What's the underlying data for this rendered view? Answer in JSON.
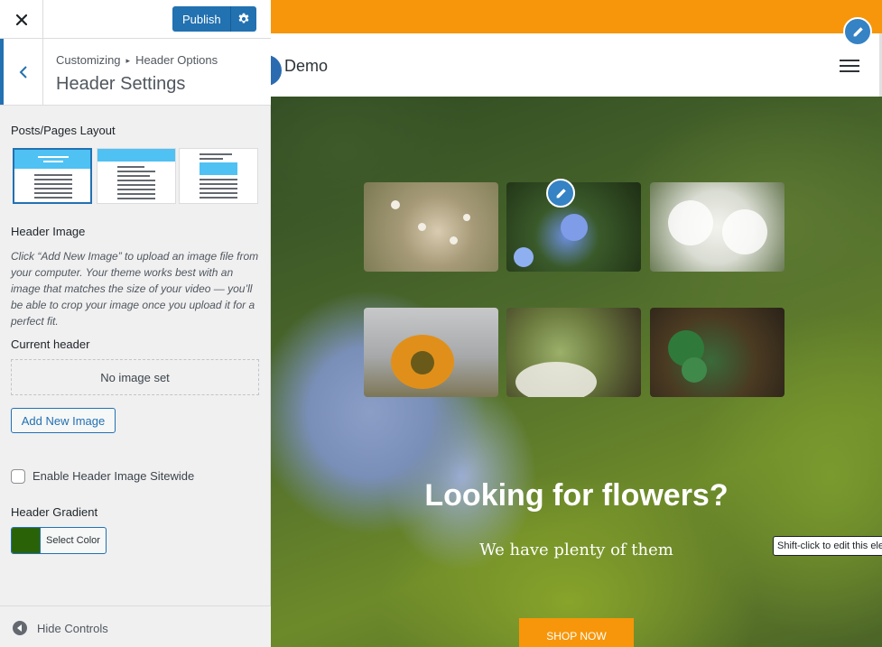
{
  "colors": {
    "accent": "#2271b1",
    "orange": "#f7960a",
    "gradient_swatch": "#2a6307",
    "logo": "#2b6cb0"
  },
  "topbar": {
    "close_icon": "close-icon",
    "publish_label": "Publish",
    "publish_settings_icon": "gear-icon"
  },
  "section": {
    "back_icon": "chevron-left-icon",
    "breadcrumb": [
      "Customizing",
      "Header Options"
    ],
    "title": "Header Settings"
  },
  "layout": {
    "label": "Posts/Pages Layout",
    "options": [
      "layout-full-banner",
      "layout-wide-banner",
      "layout-boxed-banner"
    ],
    "selected": 0
  },
  "header_image": {
    "label": "Header Image",
    "description": "Click “Add New Image” to upload an image file from your computer. Your theme works best with an image that matches the size of your video — you’ll be able to crop your image once you upload it for a perfect fit.",
    "current_label": "Current header",
    "current_value": "No image set",
    "add_button": "Add New Image"
  },
  "sitewide": {
    "label": "Enable Header Image Sitewide",
    "checked": false
  },
  "gradient": {
    "label": "Header Gradient",
    "button": "Select Color"
  },
  "footer": {
    "hide_label": "Hide Controls"
  },
  "preview": {
    "site_name": "Demo",
    "hero_title": "Looking for flowers?",
    "hero_subtitle": "We have plenty of them",
    "shop_button": "SHOP NOW",
    "tooltip": "Shift-click to edit this element."
  }
}
